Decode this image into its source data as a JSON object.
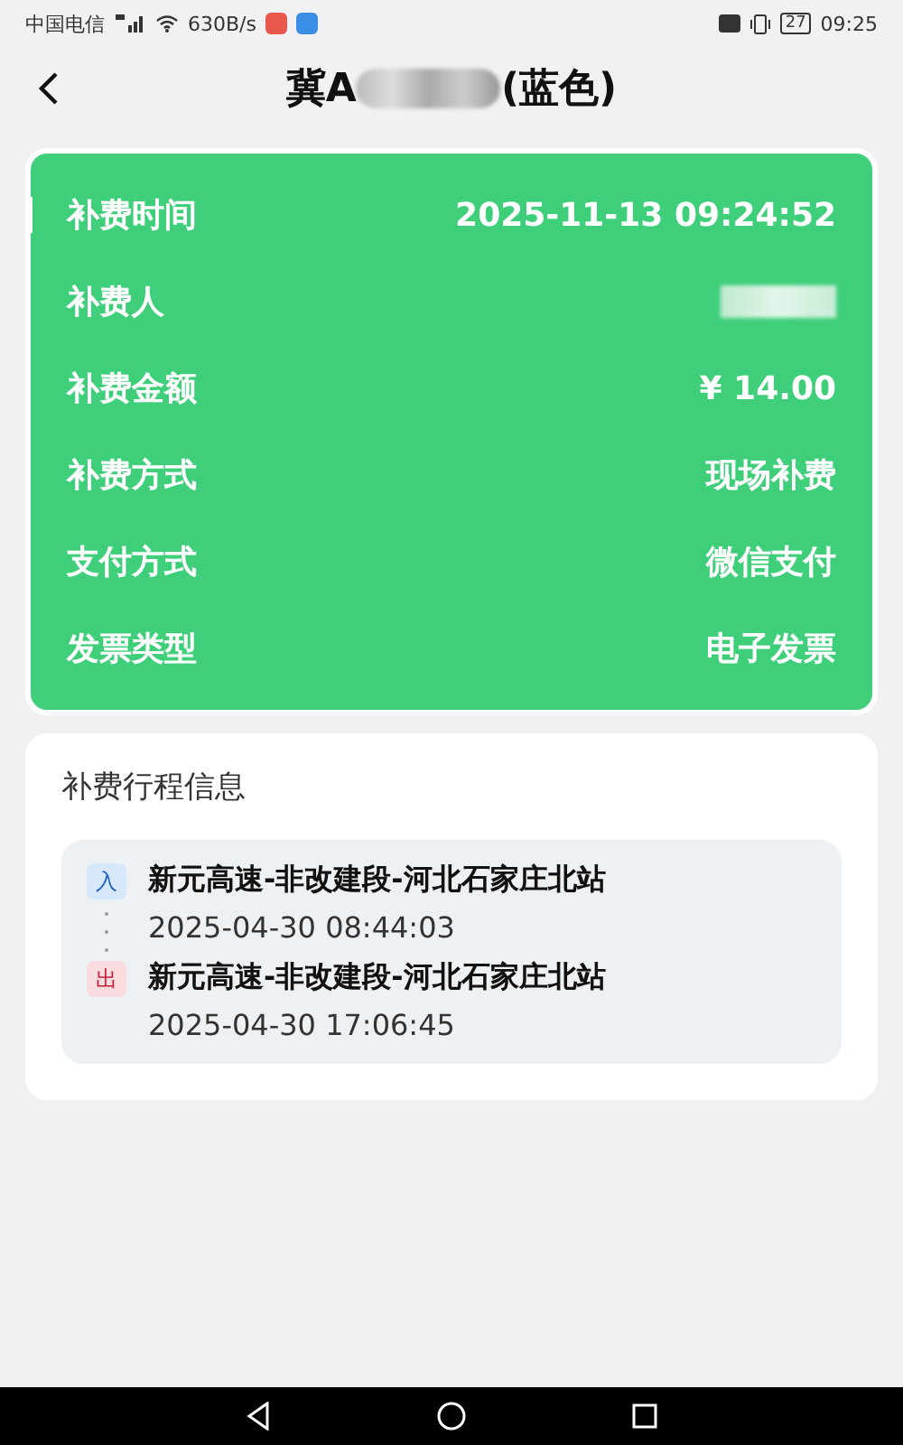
{
  "status_bar": {
    "carrier": "中国电信",
    "speed": "630B/s",
    "battery": "27",
    "time": "09:25"
  },
  "header": {
    "title_prefix": "冀A",
    "title_suffix": "(蓝色)"
  },
  "summary": {
    "rows": [
      {
        "label": "补费时间",
        "value": "2025-11-13 09:24:52",
        "selected": true
      },
      {
        "label": "补费人",
        "kind": "redacted",
        "selected": false
      },
      {
        "label": "补费金额",
        "value": "¥ 14.00",
        "selected": false
      },
      {
        "label": "补费方式",
        "value": "现场补费",
        "selected": false
      },
      {
        "label": "支付方式",
        "value": "微信支付",
        "selected": false
      },
      {
        "label": "发票类型",
        "value": "电子发票",
        "selected": false
      }
    ]
  },
  "trip": {
    "title": "补费行程信息",
    "stops": [
      {
        "kind": "entry",
        "badge": "入",
        "station": "新元高速-非改建段-河北石家庄北站",
        "time": "2025-04-30 08:44:03"
      },
      {
        "kind": "exit",
        "badge": "出",
        "station": "新元高速-非改建段-河北石家庄北站",
        "time": "2025-04-30 17:06:45"
      }
    ]
  }
}
